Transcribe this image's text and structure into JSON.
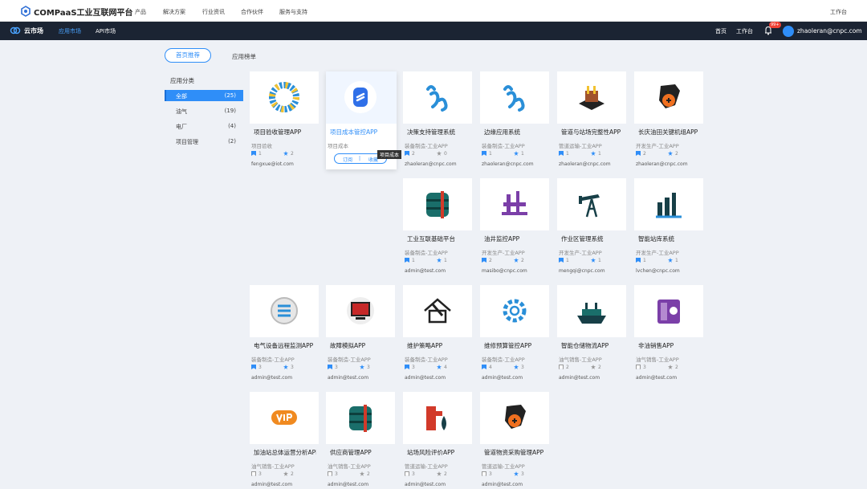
{
  "top": {
    "brand": "COMPaaS工业互联网平台",
    "menu": [
      "产品",
      "解决方案",
      "行业资讯",
      "合作伙伴",
      "服务与支持"
    ],
    "right": "工作台"
  },
  "nav": {
    "market": "云市场",
    "tabs": [
      "应用市场",
      "API市场"
    ],
    "links": [
      "首页",
      "工作台"
    ],
    "badge": "99+",
    "user": "zhaoleran@cnpc.com"
  },
  "tabs": {
    "recommend": "首页推荐",
    "rank": "应用榜单"
  },
  "sidebar": {
    "title": "应用分类",
    "items": [
      {
        "name": "全部",
        "count": "(25)"
      },
      {
        "name": "油气",
        "count": "(19)"
      },
      {
        "name": "电厂",
        "count": "(4)"
      },
      {
        "name": "项目管理",
        "count": "(2)"
      }
    ]
  },
  "hover": {
    "subscribe": "订阅",
    "divider": "|",
    "favorite": "收藏",
    "tooltip": "项目成本"
  },
  "cards": [
    {
      "name": "项目验收管理APP",
      "cat": "项目验收",
      "b": "1",
      "s": "2",
      "email": "fengxue@iot.com",
      "icon": "ring-icon",
      "bm": true,
      "st": true
    },
    {
      "name": "项目成本管控APP",
      "cat": "项目成本",
      "b": "",
      "s": "",
      "email": "",
      "icon": "app-s-icon"
    },
    {
      "name": "决策支持管理系统",
      "cat": "装备制造-工业APP",
      "b": "2",
      "s": "0",
      "email": "zhaoleran@cnpc.com",
      "icon": "swirl-icon",
      "bm": true,
      "st": false
    },
    {
      "name": "边缘应用系统",
      "cat": "装备制造-工业APP",
      "b": "1",
      "s": "1",
      "email": "zhaoleran@cnpc.com",
      "icon": "swirl-icon",
      "bm": true,
      "st": true
    },
    {
      "name": "管道与站场完整性APP",
      "cat": "管道运输-工业APP",
      "b": "1",
      "s": "1",
      "email": "zhaoleran@cnpc.com",
      "icon": "station-icon",
      "bm": true,
      "st": true
    },
    {
      "name": "长庆油田关键机组APP",
      "cat": "开发生产-工业APP",
      "b": "2",
      "s": "2",
      "email": "zhaoleran@cnpc.com",
      "icon": "drill-icon",
      "bm": true,
      "st": true
    },
    {
      "name": "工业互联基础平台",
      "cat": "装备制造-工业APP",
      "b": "1",
      "s": "1",
      "email": "admin@test.com",
      "icon": "tank-icon",
      "bm": true,
      "st": true
    },
    {
      "name": "油井监控APP",
      "cat": "开发生产-工业APP",
      "b": "2",
      "s": "2",
      "email": "masibo@cnpc.com",
      "icon": "rig-icon",
      "bm": true,
      "st": true
    },
    {
      "name": "作业区管理系统",
      "cat": "开发生产-工业APP",
      "b": "1",
      "s": "1",
      "email": "mengqi@cnpc.com",
      "icon": "pumpjack-icon",
      "bm": true,
      "st": true
    },
    {
      "name": "智能站库系统",
      "cat": "开发生产-工业APP",
      "b": "1",
      "s": "1",
      "email": "lvchen@cnpc.com",
      "icon": "refinery-icon",
      "bm": true,
      "st": true
    },
    {
      "name": "电气设备远程监测APP",
      "cat": "装备制造-工业APP",
      "b": "3",
      "s": "3",
      "email": "admin@test.com",
      "icon": "scan-icon",
      "bm": true,
      "st": true
    },
    {
      "name": "故障模拟APP",
      "cat": "装备制造-工业APP",
      "b": "3",
      "s": "3",
      "email": "admin@test.com",
      "icon": "monitor-icon",
      "bm": true,
      "st": true
    },
    {
      "name": "维护策略APP",
      "cat": "装备制造-工业APP",
      "b": "3",
      "s": "4",
      "email": "admin@test.com",
      "icon": "house-tool-icon",
      "bm": true,
      "st": true
    },
    {
      "name": "维修预算管控APP",
      "cat": "装备制造-工业APP",
      "b": "4",
      "s": "3",
      "email": "admin@test.com",
      "icon": "gear-icon",
      "bm": true,
      "st": true
    },
    {
      "name": "智能仓储物流APP",
      "cat": "油气销售-工业APP",
      "b": "2",
      "s": "2",
      "email": "admin@test.com",
      "icon": "ship-icon",
      "bm": false,
      "st": false
    },
    {
      "name": "非油销售APP",
      "cat": "油气销售-工业APP",
      "b": "3",
      "s": "2",
      "email": "admin@test.com",
      "icon": "machine-icon",
      "bm": false,
      "st": false
    },
    {
      "name": "加油站总体运营分析APP",
      "cat": "油气销售-工业APP",
      "b": "3",
      "s": "2",
      "email": "admin@test.com",
      "icon": "vip-icon",
      "bm": false,
      "st": false
    },
    {
      "name": "供应商管理APP",
      "cat": "油气销售-工业APP",
      "b": "3",
      "s": "2",
      "email": "admin@test.com",
      "icon": "tank-icon",
      "bm": false,
      "st": false
    },
    {
      "name": "站场风险评价APP",
      "cat": "管道运输-工业APP",
      "b": "3",
      "s": "2",
      "email": "admin@test.com",
      "icon": "drop-icon",
      "bm": false,
      "st": false
    },
    {
      "name": "管道物资采购管理APP",
      "cat": "管道运输-工业APP",
      "b": "3",
      "s": "3",
      "email": "admin@test.com",
      "icon": "drill-icon",
      "bm": false,
      "st": true
    }
  ]
}
